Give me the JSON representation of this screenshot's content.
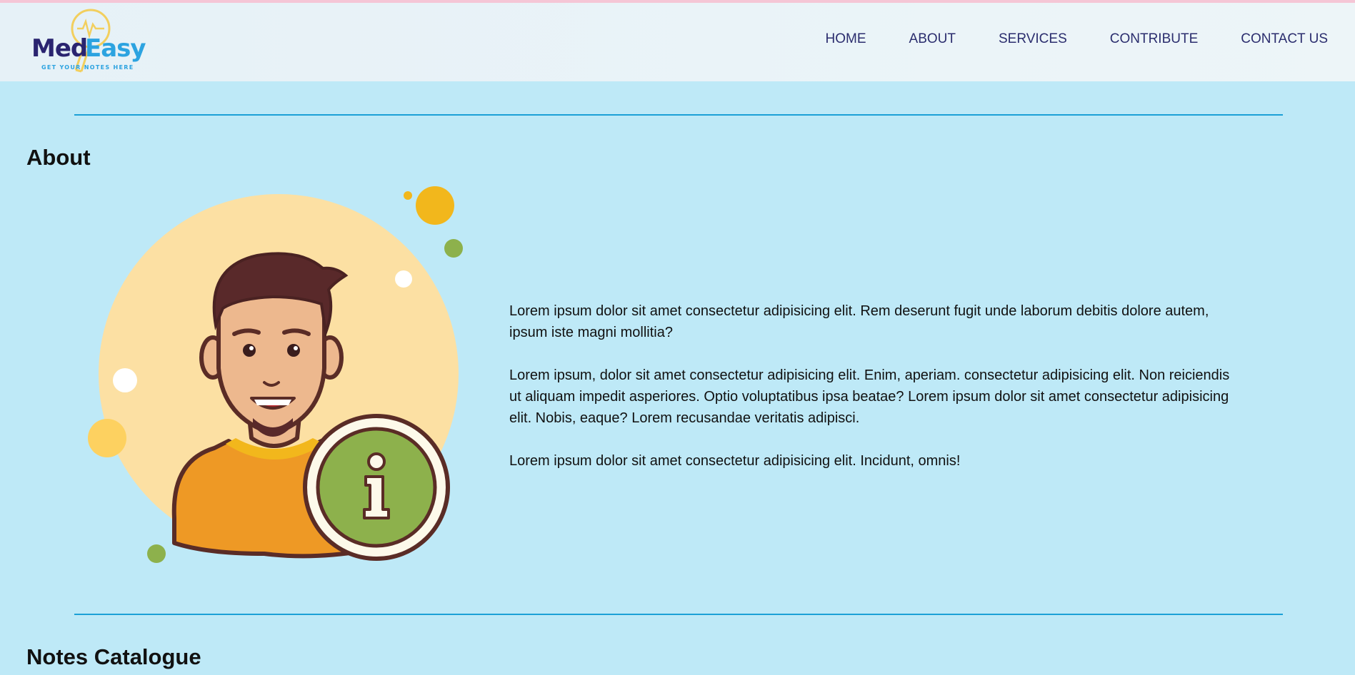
{
  "brand": {
    "name_part1": "Med",
    "name_part2": "Easy",
    "tagline": "GET YOUR NOTES HERE"
  },
  "nav": {
    "items": [
      {
        "label": "HOME"
      },
      {
        "label": "ABOUT"
      },
      {
        "label": "SERVICES"
      },
      {
        "label": "CONTRIBUTE"
      },
      {
        "label": "CONTACT US"
      }
    ]
  },
  "about": {
    "title": "About",
    "paragraphs": [
      "Lorem ipsum dolor sit amet consectetur adipisicing elit. Rem deserunt fugit unde laborum debitis dolore autem, ipsum iste magni mollitia?",
      "Lorem ipsum, dolor sit amet consectetur adipisicing elit. Enim, aperiam. consectetur adipisicing elit. Non reiciendis ut aliquam impedit asperiores. Optio voluptatibus ipsa beatae? Lorem ipsum dolor sit amet consectetur adipisicing elit. Nobis, eaque? Lorem recusandae veritatis adipisci.",
      "Lorem ipsum dolor sit amet consectetur adipisicing elit. Incidunt, omnis!"
    ]
  },
  "notes": {
    "title": "Notes Catalogue"
  },
  "colors": {
    "background": "#bee9f7",
    "rule": "#1ba0d6",
    "nav_text": "#2b2d6e",
    "brand_dark": "#2a2470",
    "brand_light": "#2ca3e0"
  }
}
